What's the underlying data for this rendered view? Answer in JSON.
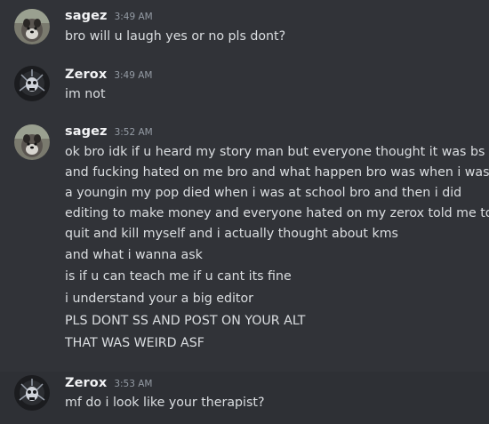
{
  "messages": [
    {
      "author": "sagez",
      "time": "3:49 AM",
      "avatar": "dog-avatar",
      "lines": [
        "bro will u laugh yes or no pls dont?"
      ]
    },
    {
      "author": "Zerox",
      "time": "3:49 AM",
      "avatar": "dark-skull-avatar",
      "lines": [
        "im not"
      ]
    },
    {
      "author": "sagez",
      "time": "3:52 AM",
      "avatar": "dog-avatar",
      "lines": [
        "ok bro idk if u heard my story man but everyone thought it was bs",
        "and fucking hated on me bro and what happen bro was when i was",
        "a youngin my pop died when i was at school bro and then i did",
        "editing to make money and everyone hated on my zerox told me to",
        "quit and kill myself and i actually thought about kms"
      ],
      "followups": [
        "and what i wanna ask",
        "is if u can teach me if u cant its fine",
        "i understand your a big editor",
        "PLS DONT SS AND POST ON YOUR ALT",
        "THAT WAS WEIRD ASF"
      ]
    },
    {
      "author": "Zerox",
      "time": "3:53 AM",
      "avatar": "dark-skull-avatar",
      "lines": [
        "mf do i look like your therapist?"
      ]
    }
  ],
  "colors": {
    "background": "#313338",
    "hover_background": "#2e3035",
    "username": "#f2f3f5",
    "text": "#dbdee1",
    "timestamp": "#949ba4"
  }
}
